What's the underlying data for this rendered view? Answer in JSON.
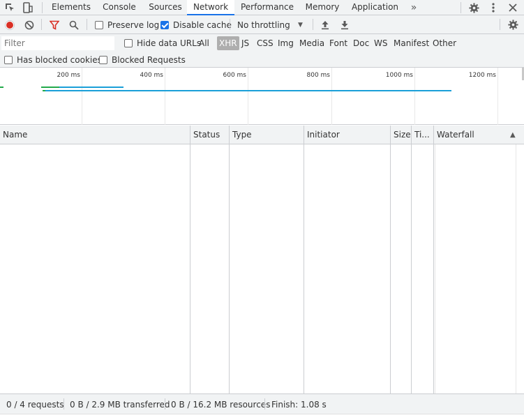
{
  "tabs": [
    "Elements",
    "Console",
    "Sources",
    "Network",
    "Performance",
    "Memory",
    "Application"
  ],
  "active_tab": "Network",
  "toolbar": {
    "preserve_log": "Preserve log",
    "disable_cache": "Disable cache",
    "throttling": "No throttling"
  },
  "filter": {
    "placeholder": "Filter",
    "hide_data_urls": "Hide data URLs",
    "types": [
      "All",
      "XHR",
      "JS",
      "CSS",
      "Img",
      "Media",
      "Font",
      "Doc",
      "WS",
      "Manifest",
      "Other"
    ],
    "active_type": "XHR"
  },
  "blocked": {
    "has_blocked_cookies": "Has blocked cookies",
    "blocked_requests": "Blocked Requests"
  },
  "overview": {
    "ticks": [
      "200 ms",
      "400 ms",
      "600 ms",
      "800 ms",
      "1000 ms",
      "1200 ms"
    ]
  },
  "table": {
    "columns": [
      "Name",
      "Status",
      "Type",
      "Initiator",
      "Size",
      "Ti...",
      "Waterfall"
    ]
  },
  "status": {
    "requests": "0 / 4 requests",
    "transferred": "0 B / 2.9 MB transferred",
    "resources": "0 B / 16.2 MB resources",
    "finish": "Finish: 1.08 s"
  },
  "colors": {
    "accent": "#1a73e8",
    "record": "#d93025",
    "filter_active": "#d93025",
    "bar_blue": "#1a9fd8",
    "bar_green": "#22a94a"
  }
}
